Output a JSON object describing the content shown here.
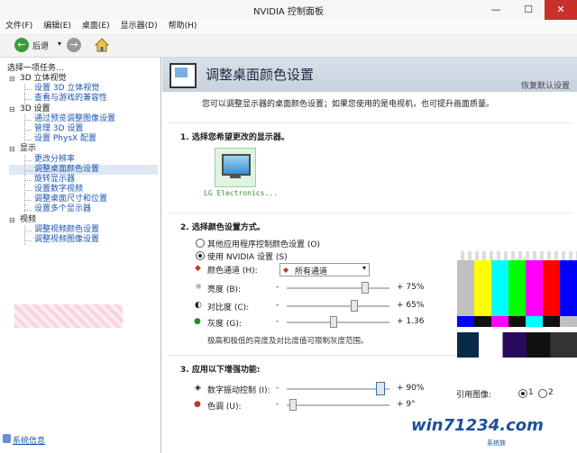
{
  "window": {
    "title": "NVIDIA 控制面板",
    "minimize": "—",
    "maximize": "☐",
    "close": "✕"
  },
  "menu": [
    "文件(F)",
    "编辑(E)",
    "桌面(E)",
    "显示器(D)",
    "帮助(H)"
  ],
  "toolbar": {
    "back_label": "后退",
    "dropdown": "▾",
    "back_glyph": "←",
    "forward_glyph": "→"
  },
  "sidebar": {
    "header": "选择一项任务...",
    "tree": [
      {
        "type": "cat",
        "label": "3D 立体视觉"
      },
      {
        "type": "item",
        "label": "设置 3D 立体视觉"
      },
      {
        "type": "item",
        "label": "查看与游戏的兼容性"
      },
      {
        "type": "cat",
        "label": "3D 设置"
      },
      {
        "type": "item",
        "label": "通过预览调整图像设置"
      },
      {
        "type": "item",
        "label": "管理 3D 设置"
      },
      {
        "type": "item",
        "label": "设置 PhysX 配置"
      },
      {
        "type": "cat",
        "label": "显示"
      },
      {
        "type": "item",
        "label": "更改分辨率"
      },
      {
        "type": "item",
        "label": "调整桌面颜色设置",
        "selected": true
      },
      {
        "type": "item",
        "label": "旋转显示器"
      },
      {
        "type": "item",
        "label": "设置数字视频"
      },
      {
        "type": "item",
        "label": "调整桌面尺寸和位置"
      },
      {
        "type": "item",
        "label": "设置多个显示器"
      },
      {
        "type": "cat",
        "label": "视频"
      },
      {
        "type": "item",
        "label": "调整视频颜色设置"
      },
      {
        "type": "item",
        "label": "调整视频图像设置"
      }
    ],
    "system_info": "系统信息"
  },
  "content": {
    "heading": "调整桌面颜色设置",
    "restore_defaults": "恢复默认设置",
    "description": "您可以调整显示器的桌面颜色设置；如果您使用的是电视机，也可提升画面质量。",
    "section1_title": "1. 选择您希望更改的显示器。",
    "display_name": "LG Electronics...",
    "section2_title": "2. 选择颜色设置方式。",
    "radio_other": "其他应用程序控制颜色设置 (O)",
    "radio_nvidia": "使用 NVIDIA 设置 (S)",
    "color_channel_label": "颜色通道 (H):",
    "color_channel_value": "所有通道",
    "brightness_label": "亮度 (B):",
    "brightness_value": "+ 75%",
    "contrast_label": "对比度 (C):",
    "contrast_value": "+ 65%",
    "gamma_label": "灰度 (G):",
    "gamma_value": "+ 1.36",
    "slider_minus": "-",
    "note": "极高和极低的亮度及对比度值可限制灰度范围。",
    "section3_title": "3. 应用以下增强功能:",
    "vibrance_label": "数字振动控制 (I):",
    "vibrance_value": "+ 90%",
    "hue_label": "色调 (U):",
    "hue_value": "+ 9°",
    "reference_label": "引用图像:",
    "ref_options": [
      "1",
      "2"
    ],
    "sliders": {
      "brightness_level": 0.75,
      "contrast_level": 0.65,
      "gamma_level": 0.45,
      "vibrance_level": 0.9,
      "hue_level": 0.05
    }
  },
  "watermark": {
    "main": "win71234.com",
    "sub": "系统族"
  },
  "colors": {
    "title_close": "#c9302c",
    "link": "#1a54b0",
    "banner": "#d8e1ea"
  }
}
